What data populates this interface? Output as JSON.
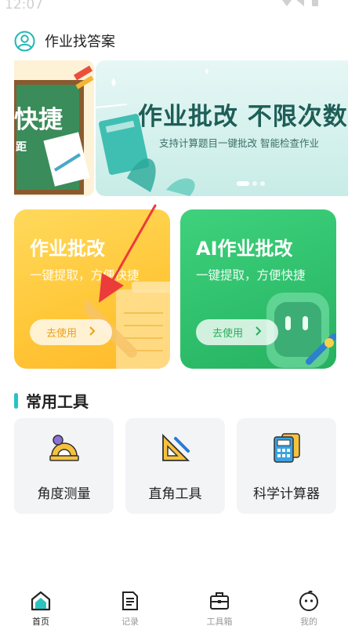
{
  "status_bar": {
    "time": "12:07"
  },
  "header": {
    "title": "作业找答案",
    "icon": "user-avatar-icon"
  },
  "banner": {
    "left_title": "快捷",
    "left_sub": "距",
    "title": "作业批改 不限次数",
    "subtitle": "支持计算题目一键批改 智能检查作业",
    "dots": 3,
    "active_dot": 0
  },
  "cards": [
    {
      "title": "作业批改",
      "subtitle": "一键提取，方便快捷",
      "button": "去使用",
      "color": "#ffc83a"
    },
    {
      "title": "AI作业批改",
      "subtitle": "一键提取，方便快捷",
      "button": "去使用",
      "color": "#2fbf6c"
    }
  ],
  "section": {
    "title": "常用工具",
    "accent": "#28c2c6"
  },
  "tools": [
    {
      "label": "角度测量",
      "icon": "protractor-icon"
    },
    {
      "label": "直角工具",
      "icon": "set-square-icon"
    },
    {
      "label": "科学计算器",
      "icon": "calculator-icon"
    }
  ],
  "tabs": [
    {
      "label": "首页",
      "icon": "home-icon",
      "active": true
    },
    {
      "label": "记录",
      "icon": "document-icon",
      "active": false
    },
    {
      "label": "工具箱",
      "icon": "toolbox-icon",
      "active": false
    },
    {
      "label": "我的",
      "icon": "smiley-icon",
      "active": false
    }
  ]
}
